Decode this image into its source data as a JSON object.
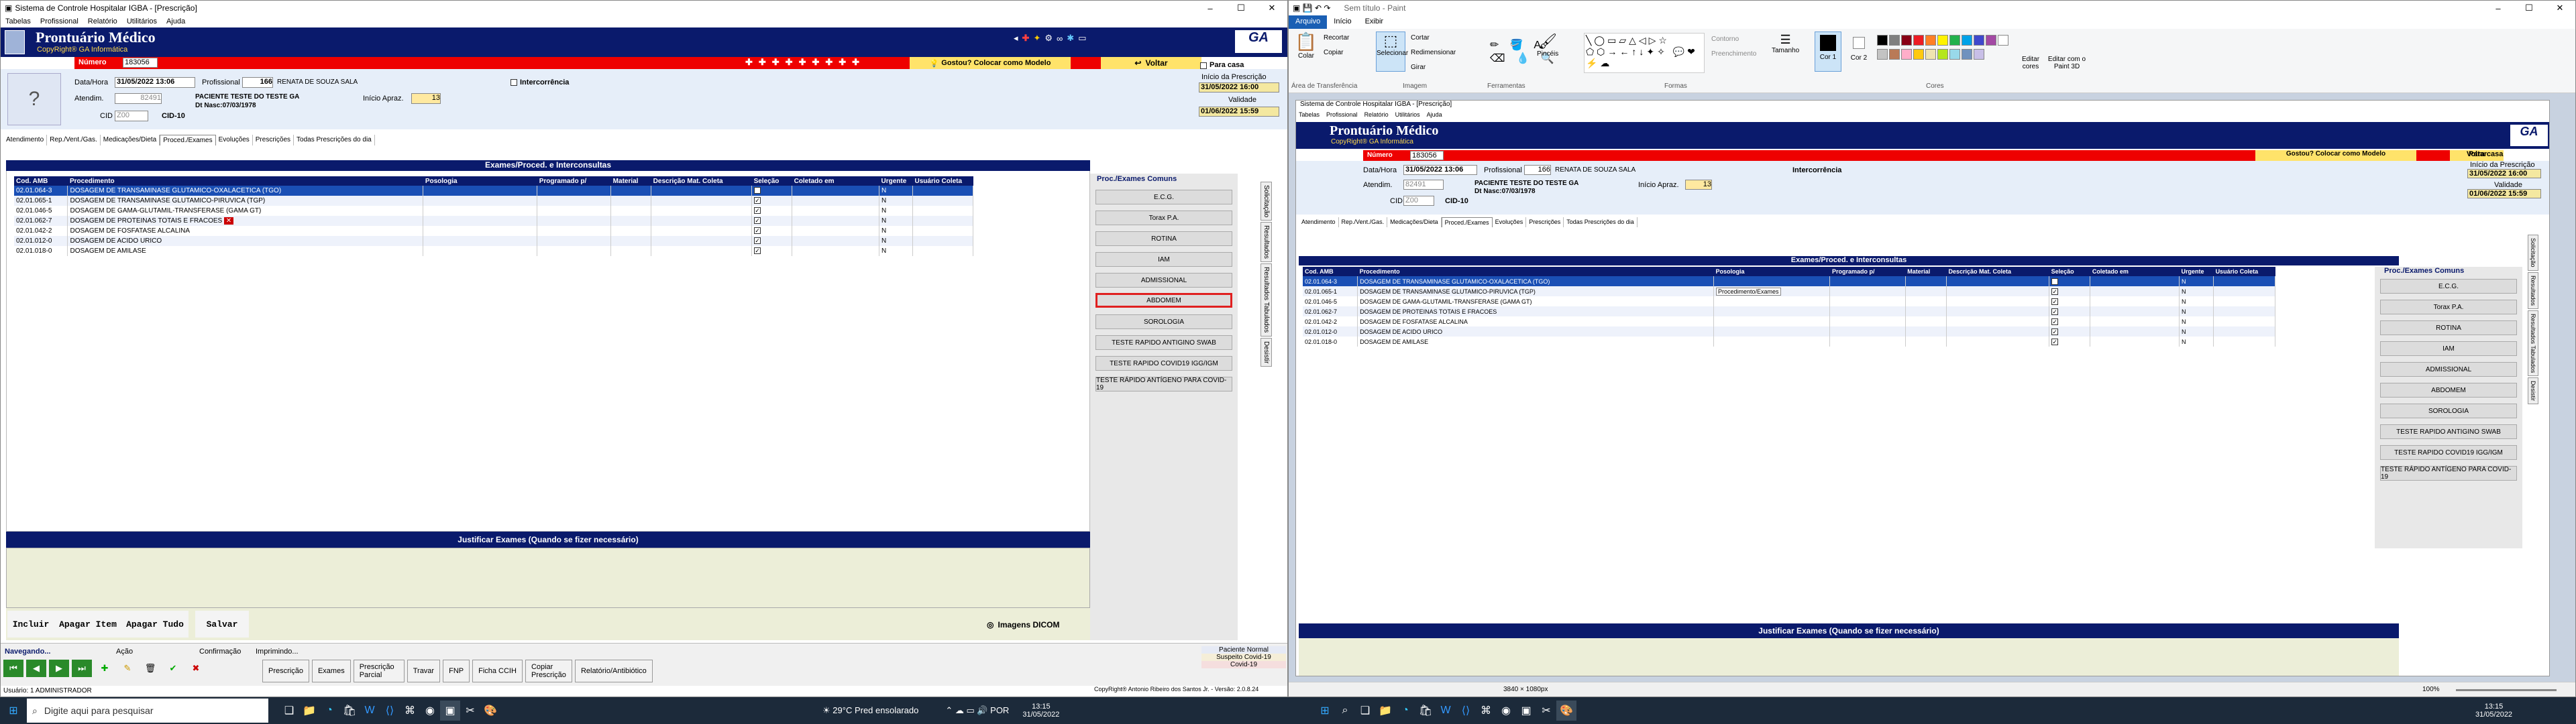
{
  "left": {
    "titlebar": {
      "title": "Sistema de Controle Hospitalar IGBA - [Prescrição]",
      "ctrl_min": "–",
      "ctrl_max": "☐",
      "ctrl_close": "✕"
    },
    "menu": [
      "Tabelas",
      "Profissional",
      "Relatório",
      "Utilitários",
      "Ajuda"
    ],
    "app": {
      "title": "Prontuário Médico",
      "subtitle": "CopyRight® GA Informática"
    },
    "numero_label": "Número",
    "numero": "183056",
    "gostou": "Gostou? Colocar como Modelo",
    "voltar": "Voltar",
    "data_label": "Data/Hora",
    "data": "31/05/2022 13:06",
    "prof_label": "Profissional",
    "prof_code": "166",
    "prof_name": "RENATA DE SOUZA SALA",
    "interc": "Intercorrência",
    "atend_label": "Atendim.",
    "atend": "82491",
    "patient": "PACIENTE TESTE DO TESTE GA",
    "nasc": "Dt Nasc:07/03/1978",
    "inicio_apraz_label": "Início Apraz.",
    "inicio_apraz": "13",
    "cid_label": "CID",
    "cid": "Z00",
    "cid10": "CID-10",
    "para_casa": "Para casa",
    "inicio_presc_label": "Início da Prescrição",
    "inicio_presc": "31/05/2022 16:00",
    "validade_label": "Validade",
    "validade": "01/06/2022 15:59",
    "tabs": [
      "Atendimento",
      "Rep./Vent./Gas.",
      "Medicações/Dieta",
      "Proced./Exames",
      "Evoluções",
      "Prescrições",
      "Todas Prescrições do dia"
    ],
    "grid_title": "Exames/Proced. e Interconsultas",
    "cols": [
      "Cod. AMB",
      "Procedimento",
      "Posologia",
      "Programado p/",
      "Material",
      "Descrição Mat. Coleta",
      "Seleção",
      "Coletado em",
      "Urgente",
      "Usuário Coleta"
    ],
    "rows": [
      {
        "cod": "02.01.064-3",
        "proc": "DOSAGEM DE TRANSAMINASE GLUTAMICO-OXALACETICA (TGO)",
        "urg": "N"
      },
      {
        "cod": "02.01.065-1",
        "proc": "DOSAGEM DE TRANSAMINASE GLUTAMICO-PIRUVICA (TGP)",
        "urg": "N"
      },
      {
        "cod": "02.01.046-5",
        "proc": "DOSAGEM DE GAMA-GLUTAMIL-TRANSFERASE (GAMA GT)",
        "urg": "N"
      },
      {
        "cod": "02.01.062-7",
        "proc": "DOSAGEM DE PROTEINAS TOTAIS E FRACOES",
        "urg": "N"
      },
      {
        "cod": "02.01.042-2",
        "proc": "DOSAGEM DE FOSFATASE ALCALINA",
        "urg": "N"
      },
      {
        "cod": "02.01.012-0",
        "proc": "DOSAGEM DE ACIDO URICO",
        "urg": "N"
      },
      {
        "cod": "02.01.018-0",
        "proc": "DOSAGEM DE AMILASE",
        "urg": "N"
      }
    ],
    "common_title": "Proc./Exames Comuns",
    "common": [
      "E.C.G.",
      "Torax P.A.",
      "ROTINA",
      "IAM",
      "ADMISSIONAL",
      "ABDOMEM",
      "SOROLOGIA",
      "TESTE RAPIDO ANTIGINO SWAB",
      "TESTE RAPIDO COVID19 IGG/IGM",
      "TESTE RÁPIDO ANTÍGENO PARA COVID-19"
    ],
    "vtabs": [
      "Solicitação",
      "Resultados",
      "Resultados Tabulados",
      "Desistir"
    ],
    "justif": "Justificar Exames (Quando  se fizer necessário)",
    "actions": [
      "Incluir",
      "Apagar Item",
      "Apagar Tudo",
      "Salvar"
    ],
    "dicom": "Imagens DICOM",
    "toolbar_labels": {
      "navegando": "Navegando...",
      "acao": "Ação",
      "confirmacao": "Confirmação",
      "imprimindo": "Imprimindo..."
    },
    "bottom_btns": [
      "Prescrição",
      "Exames",
      "Prescrição Parcial",
      "Travar",
      "FNP",
      "Ficha CCIH",
      "Copiar Prescrição",
      "Relatório/Antibiótico"
    ],
    "status_right": [
      "Paciente Normal",
      "Suspeito Covid-19",
      "Covid-19"
    ],
    "copyright": "CopyRight® Antonio Ribeiro dos Santos Jr. - Versão: 2.0.8.24",
    "usuario": "Usuário: 1 ADMINISTRADOR"
  },
  "paint": {
    "title": "Sem título - Paint",
    "tabs": [
      "Arquivo",
      "Início",
      "Exibir"
    ],
    "groups": {
      "clipboard": [
        "Colar",
        "Recortar",
        "Copiar"
      ],
      "clipboard_label": "Área de Transferência",
      "image": [
        "Selecionar",
        "Cortar",
        "Redimensionar",
        "Girar"
      ],
      "image_label": "Imagem",
      "tools_label": "Ferramentas",
      "brushes": "Pincéis",
      "shapes_label": "Formas",
      "contorno": "Contorno",
      "preenchimento": "Preenchimento",
      "tamanho": "Tamanho",
      "cor1": "Cor 1",
      "cor2": "Cor 2",
      "editar_cores": "Editar cores",
      "paint3d": "Editar com o Paint 3D",
      "cores_label": "Cores"
    },
    "status": {
      "dims": "3840 × 1080px",
      "zoom": "100%"
    },
    "palette": [
      "#000000",
      "#7f7f7f",
      "#880015",
      "#ed1c24",
      "#ff7f27",
      "#fff200",
      "#22b14c",
      "#00a2e8",
      "#3f48cc",
      "#a349a4",
      "#ffffff",
      "#c3c3c3",
      "#b97a57",
      "#ffaec9",
      "#ffc90e",
      "#efe4b0",
      "#b5e61d",
      "#99d9ea",
      "#7092be",
      "#c8bfe7"
    ],
    "tooltip": "Procedimento/Exames"
  },
  "taskbar": {
    "search": "Digite aqui para pesquisar",
    "weather": "29°C  Pred ensolarado",
    "time": "13:15",
    "date": "31/05/2022"
  }
}
